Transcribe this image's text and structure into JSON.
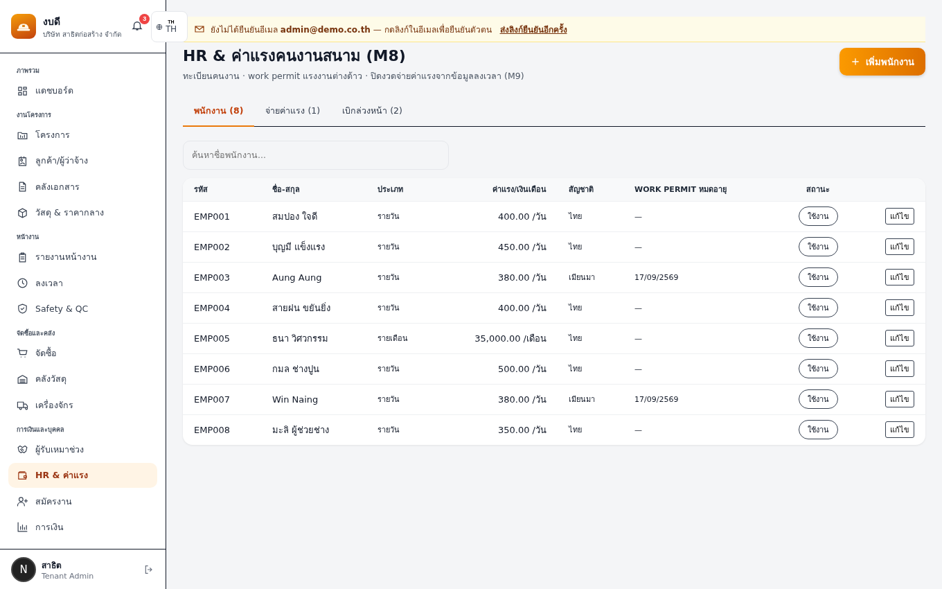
{
  "brand": {
    "name": "งบดี",
    "company": "บริษัท สาธิตก่อสร้าง จำกัด"
  },
  "notifications": {
    "count": "3"
  },
  "language": {
    "small": "TH",
    "label": "TH"
  },
  "sidebar": {
    "sections": [
      {
        "title": "ภาพรวม",
        "items": [
          {
            "label": "แดชบอร์ด",
            "selected": false
          }
        ]
      },
      {
        "title": "งานโครงการ",
        "items": [
          {
            "label": "โครงการ",
            "selected": false
          },
          {
            "label": "ลูกค้า/ผู้ว่าจ้าง",
            "selected": false
          },
          {
            "label": "คลังเอกสาร",
            "selected": false
          },
          {
            "label": "วัสดุ & ราคากลาง",
            "selected": false
          }
        ]
      },
      {
        "title": "หน้างาน",
        "items": [
          {
            "label": "รายงานหน้างาน",
            "selected": false
          },
          {
            "label": "ลงเวลา",
            "selected": false
          },
          {
            "label": "Safety & QC",
            "selected": false
          }
        ]
      },
      {
        "title": "จัดซื้อและคลัง",
        "items": [
          {
            "label": "จัดซื้อ",
            "selected": false
          },
          {
            "label": "คลังวัสดุ",
            "selected": false
          },
          {
            "label": "เครื่องจักร",
            "selected": false
          }
        ]
      },
      {
        "title": "การเงินและบุคคล",
        "items": [
          {
            "label": "ผู้รับเหมาช่วง",
            "selected": false
          },
          {
            "label": "HR & ค่าแรง",
            "selected": true
          },
          {
            "label": "สมัครงาน",
            "selected": false
          },
          {
            "label": "การเงิน",
            "selected": false
          }
        ]
      }
    ]
  },
  "user": {
    "avatar": "N",
    "name": "สาธิต",
    "role": "Tenant Admin"
  },
  "banner": {
    "text": "ยังไม่ได้ยืนยันอีเมล **admin@demo.co.th** — กดลิงก์ในอีเมลเพื่อยืนยันตัวตน",
    "link": "ส่งลิงก์ยืนยันอีกครั้ง"
  },
  "page": {
    "title": "HR & ค่าแรงคนงานสนาม (M8)",
    "subtitle": "ทะเบียนคนงาน · work permit แรงงานต่างด้าว · ปิดงวดจ่ายค่าแรงจากข้อมูลลงเวลา (M9)",
    "add_button": "เพิ่มพนักงาน"
  },
  "tabs": [
    {
      "label": "พนักงาน (8)",
      "selected": true
    },
    {
      "label": "จ่ายค่าแรง (1)",
      "selected": false
    },
    {
      "label": "เบิกล่วงหน้า (2)",
      "selected": false
    }
  ],
  "search": {
    "placeholder": "ค้นหาชื่อพนักงาน..."
  },
  "table": {
    "columns": [
      "รหัส",
      "ชื่อ-สกุล",
      "ประเภท",
      "ค่าแรง/เงินเดือน",
      "สัญชาติ",
      "WORK PERMIT หมดอายุ",
      "สถานะ"
    ],
    "rows": [
      {
        "id": "EMP001",
        "name": "สมปอง ใจดี",
        "type": "รายวัน",
        "wage": "400.00 /วัน",
        "nationality": "ไทย",
        "permit": "—",
        "status": "ใช้งาน",
        "action": "แก้ไข"
      },
      {
        "id": "EMP002",
        "name": "บุญมี แข็งแรง",
        "type": "รายวัน",
        "wage": "450.00 /วัน",
        "nationality": "ไทย",
        "permit": "—",
        "status": "ใช้งาน",
        "action": "แก้ไข"
      },
      {
        "id": "EMP003",
        "name": "Aung Aung",
        "type": "รายวัน",
        "wage": "380.00 /วัน",
        "nationality": "เมียนมา",
        "permit": "17/09/2569",
        "status": "ใช้งาน",
        "action": "แก้ไข"
      },
      {
        "id": "EMP004",
        "name": "สายฝน ขยันยิ่ง",
        "type": "รายวัน",
        "wage": "400.00 /วัน",
        "nationality": "ไทย",
        "permit": "—",
        "status": "ใช้งาน",
        "action": "แก้ไข"
      },
      {
        "id": "EMP005",
        "name": "ธนา วิศวกรรม",
        "type": "รายเดือน",
        "wage": "35,000.00 /เดือน",
        "nationality": "ไทย",
        "permit": "—",
        "status": "ใช้งาน",
        "action": "แก้ไข"
      },
      {
        "id": "EMP006",
        "name": "กมล ช่างปูน",
        "type": "รายวัน",
        "wage": "500.00 /วัน",
        "nationality": "ไทย",
        "permit": "—",
        "status": "ใช้งาน",
        "action": "แก้ไข"
      },
      {
        "id": "EMP007",
        "name": "Win Naing",
        "type": "รายวัน",
        "wage": "380.00 /วัน",
        "nationality": "เมียนมา",
        "permit": "17/09/2569",
        "status": "ใช้งาน",
        "action": "แก้ไข"
      },
      {
        "id": "EMP008",
        "name": "มะลิ ผู้ช่วยช่าง",
        "type": "รายวัน",
        "wage": "350.00 /วัน",
        "nationality": "ไทย",
        "permit": "—",
        "status": "ใช้งาน",
        "action": "แก้ไข"
      }
    ]
  }
}
